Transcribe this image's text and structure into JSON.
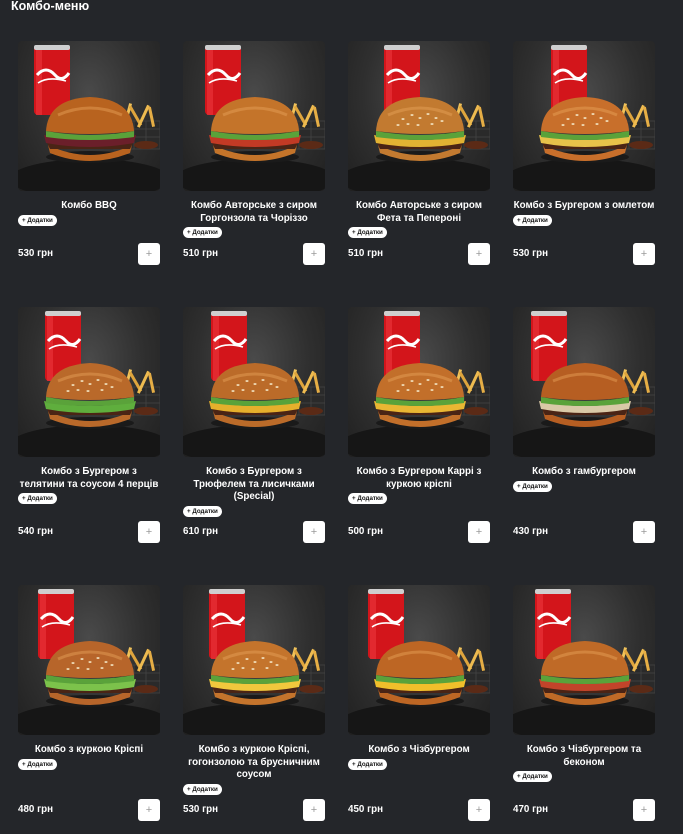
{
  "section": {
    "title": "Комбо-меню"
  },
  "common": {
    "addons_label": "+ Додатки",
    "add_icon": "plus-icon"
  },
  "items": [
    {
      "name": "Комбо BBQ",
      "price": "530 грн",
      "lines": 1,
      "style": "bbq"
    },
    {
      "name": "Комбо Авторське з сиром Горгонзола та Чоріззо",
      "price": "510 грн",
      "lines": 2,
      "style": "autor1"
    },
    {
      "name": "Комбо Авторське з сиром Фета та Пепероні",
      "price": "510 грн",
      "lines": 2,
      "style": "autor2"
    },
    {
      "name": "Комбо з Бургером з омлетом",
      "price": "530 грн",
      "lines": 1,
      "style": "omelet"
    },
    {
      "name": "Комбо з Бургером з телятини та соусом 4 перців",
      "price": "540 грн",
      "lines": 2,
      "style": "veal"
    },
    {
      "name": "Комбо з Бургером з Трюфелем та лисичками (Special)",
      "price": "610 грн",
      "lines": 3,
      "style": "truffle"
    },
    {
      "name": "Комбо з Бургером Каррі з куркою кріспі",
      "price": "500 грн",
      "lines": 2,
      "style": "curry"
    },
    {
      "name": "Комбо з гамбургером",
      "price": "430 грн",
      "lines": 1,
      "style": "hamb"
    },
    {
      "name": "Комбо з куркою Кріспі",
      "price": "480 грн",
      "lines": 1,
      "style": "crispy"
    },
    {
      "name": "Комбо з куркою Кріспі, гогонзолою та брусничним соусом",
      "price": "530 грн",
      "lines": 3,
      "style": "crispy2"
    },
    {
      "name": "Комбо з Чізбургером",
      "price": "450 грн",
      "lines": 1,
      "style": "cheese"
    },
    {
      "name": "Комбо з Чізбургером та беконом",
      "price": "470 грн",
      "lines": 2,
      "style": "bacon"
    }
  ]
}
